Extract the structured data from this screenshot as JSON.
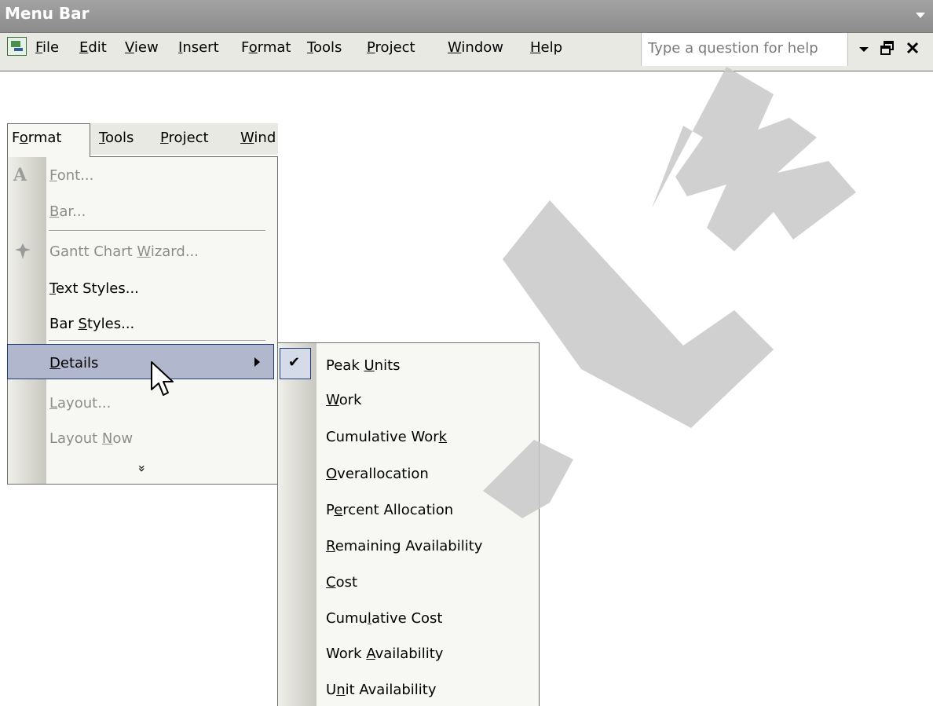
{
  "menubar": {
    "title": "Menu Bar",
    "items": [
      {
        "pre": "",
        "key": "F",
        "post": "ile"
      },
      {
        "pre": "",
        "key": "E",
        "post": "dit"
      },
      {
        "pre": "",
        "key": "V",
        "post": "iew"
      },
      {
        "pre": "",
        "key": "I",
        "post": "nsert"
      },
      {
        "pre": "F",
        "key": "o",
        "post": "rmat"
      },
      {
        "pre": "",
        "key": "T",
        "post": "ools"
      },
      {
        "pre": "",
        "key": "P",
        "post": "roject"
      },
      {
        "pre": "",
        "key": "W",
        "post": "indow"
      },
      {
        "pre": "",
        "key": "H",
        "post": "elp"
      }
    ],
    "help_placeholder": "Type a question for help"
  },
  "format_menu": {
    "header": [
      {
        "pre": "F",
        "key": "o",
        "post": "rmat"
      },
      {
        "pre": "",
        "key": "T",
        "post": "ools"
      },
      {
        "pre": "",
        "key": "P",
        "post": "roject"
      },
      {
        "pre": "",
        "key": "W",
        "post": "ind"
      }
    ],
    "items": [
      {
        "pre": "",
        "key": "F",
        "post": "ont...",
        "disabled": true
      },
      {
        "pre": "",
        "key": "B",
        "post": "ar...",
        "disabled": true
      },
      {
        "pre": "Gantt Chart ",
        "key": "W",
        "post": "izard...",
        "disabled": true
      },
      {
        "pre": "",
        "key": "T",
        "post": "ext Styles...",
        "disabled": false
      },
      {
        "pre": "Bar ",
        "key": "S",
        "post": "tyles...",
        "disabled": false
      },
      {
        "pre": "",
        "key": "D",
        "post": "etails",
        "disabled": false
      },
      {
        "pre": "",
        "key": "L",
        "post": "ayout...",
        "disabled": true
      },
      {
        "pre": "Layout ",
        "key": "N",
        "post": "ow",
        "disabled": true
      }
    ],
    "more_symbol": "»"
  },
  "details_submenu": {
    "check_mark": "✔",
    "items": [
      {
        "pre": "Peak ",
        "key": "U",
        "post": "nits",
        "checked": true
      },
      {
        "pre": "",
        "key": "W",
        "post": "ork",
        "checked": false
      },
      {
        "pre": "Cumulative Wor",
        "key": "k",
        "post": "",
        "checked": false
      },
      {
        "pre": "",
        "key": "O",
        "post": "verallocation",
        "checked": false
      },
      {
        "pre": "P",
        "key": "e",
        "post": "rcent Allocation",
        "checked": false
      },
      {
        "pre": "",
        "key": "R",
        "post": "emaining Availability",
        "checked": false
      },
      {
        "pre": "",
        "key": "C",
        "post": "ost",
        "checked": false
      },
      {
        "pre": "Cumu",
        "key": "l",
        "post": "ative Cost",
        "checked": false
      },
      {
        "pre": "Work ",
        "key": "A",
        "post": "vailability",
        "checked": false
      },
      {
        "pre": "U",
        "key": "n",
        "post": "it Availability",
        "checked": false
      }
    ]
  },
  "colors": {
    "menu_bg": "#f7f7f3",
    "highlight": "#b1b7cc",
    "highlight_border": "#1f3c78",
    "watermark": "#c8c8c8"
  }
}
